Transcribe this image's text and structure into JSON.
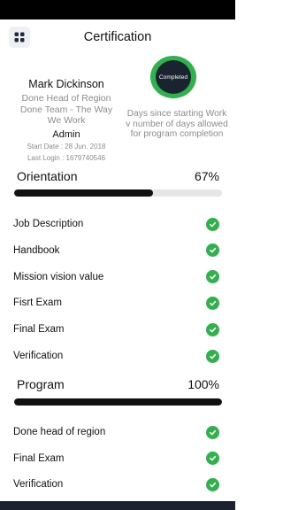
{
  "header": {
    "title": "Certification",
    "menu_icon": "grid-icon"
  },
  "profile": {
    "name": "Mark Dickinson",
    "role_line1": "Done Head of Region",
    "role_line2": "Done Team - The Way",
    "role_line3": "We Work",
    "admin": "Admin",
    "start_date": "Start Date : 28 Jun. 2018",
    "last_login": "Last Login : 1679740546"
  },
  "badge": {
    "label": "Completed",
    "caption": "Days since starting Work v number of days allowed for program completion",
    "ring_color": "#2fb24c",
    "fill_color": "#1a2430"
  },
  "orientation": {
    "title": "Orientation",
    "percent_label": "67%",
    "progress": 67,
    "items": [
      {
        "label": "Job Description",
        "icon": "check-circle-icon"
      },
      {
        "label": "Handbook",
        "icon": "check-circle-icon"
      },
      {
        "label": "Mission vision value",
        "icon": "check-circle-icon"
      },
      {
        "label": "Fisrt Exam",
        "icon": "check-circle-icon"
      },
      {
        "label": "Final Exam",
        "icon": "check-circle-icon"
      },
      {
        "label": "Verification",
        "icon": "check-circle-icon"
      }
    ]
  },
  "program": {
    "title": "Program",
    "percent_label": "100%",
    "progress": 100,
    "items": [
      {
        "label": "Done head of region",
        "icon": "check-circle-icon"
      },
      {
        "label": "Final Exam",
        "icon": "check-circle-icon"
      },
      {
        "label": "Verification",
        "icon": "check-circle-icon"
      }
    ]
  },
  "colors": {
    "accent_green": "#2fb24c",
    "bar": "#111111"
  }
}
